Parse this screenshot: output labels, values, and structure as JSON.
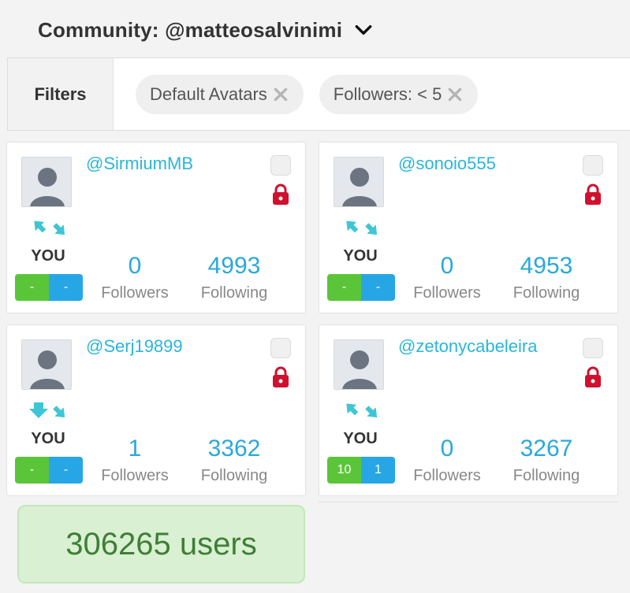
{
  "header": {
    "title": "Community: @matteosalvinimi"
  },
  "filters": {
    "label": "Filters",
    "chips": [
      {
        "label": "Default Avatars"
      },
      {
        "label": "Followers: < 5"
      }
    ]
  },
  "users": [
    {
      "handle": "@SirmiumMB",
      "you_label": "YOU",
      "bar_left": "-",
      "bar_right": "-",
      "followers": "0",
      "followers_label": "Followers",
      "following": "4993",
      "following_label": "Following"
    },
    {
      "handle": "@sonoio555",
      "you_label": "YOU",
      "bar_left": "-",
      "bar_right": "-",
      "followers": "0",
      "followers_label": "Followers",
      "following": "4953",
      "following_label": "Following"
    },
    {
      "handle": "@Serj19899",
      "you_label": "YOU",
      "bar_left": "-",
      "bar_right": "-",
      "followers": "1",
      "followers_label": "Followers",
      "following": "3362",
      "following_label": "Following"
    },
    {
      "handle": "@zetonycabeleira",
      "you_label": "YOU",
      "bar_left": "10",
      "bar_right": "1",
      "followers": "0",
      "followers_label": "Followers",
      "following": "3267",
      "following_label": "Following"
    }
  ],
  "total": {
    "text": "306265 users"
  },
  "colors": {
    "accent": "#29b6d8",
    "lock": "#d0102d",
    "green": "#5bc53a",
    "blue": "#27a6e6",
    "relation_icon": "#3ec6d6"
  },
  "icons": {
    "chevron": "chevron-down-icon",
    "remove": "close-icon",
    "private": "lock-icon",
    "relation": "relationship-arrows-icon",
    "avatar": "default-avatar-icon"
  }
}
